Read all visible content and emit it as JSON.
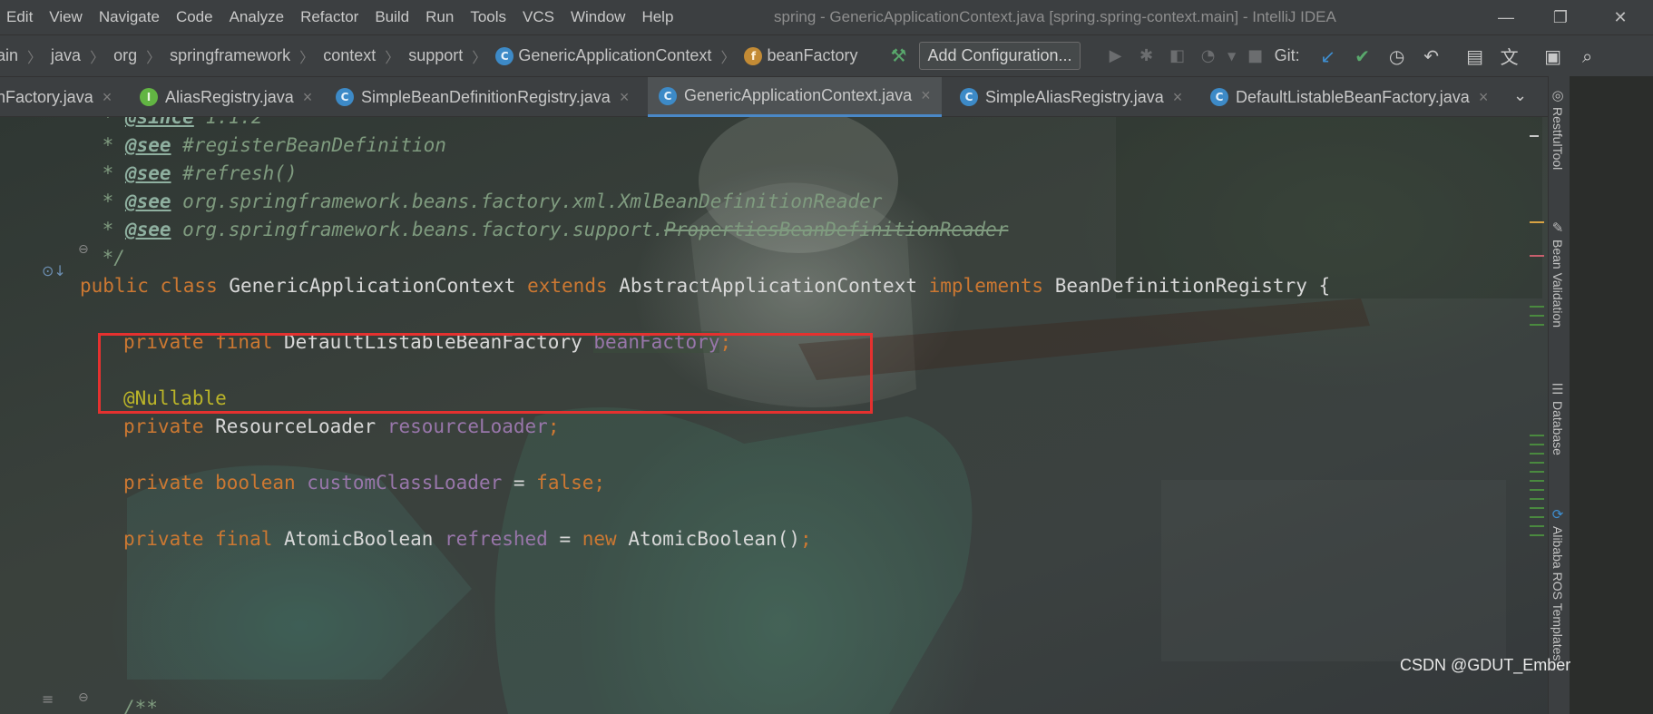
{
  "menu": {
    "items": [
      "Edit",
      "View",
      "Navigate",
      "Code",
      "Analyze",
      "Refactor",
      "Build",
      "Run",
      "Tools",
      "VCS",
      "Window",
      "Help"
    ],
    "window_title": "spring - GenericApplicationContext.java [spring.spring-context.main] - IntelliJ IDEA"
  },
  "window_controls": {
    "minimize": "—",
    "restore": "❐",
    "close": "✕"
  },
  "navbar": {
    "breadcrumbs": [
      "ain",
      "java",
      "org",
      "springframework",
      "context",
      "support",
      "GenericApplicationContext",
      "beanFactory"
    ],
    "add_configuration": "Add Configuration...",
    "git_label": "Git:"
  },
  "tabs": [
    {
      "label": "nFactory.java",
      "icon": "none",
      "active": false
    },
    {
      "label": "AliasRegistry.java",
      "icon": "interface-icon",
      "active": false
    },
    {
      "label": "SimpleBeanDefinitionRegistry.java",
      "icon": "class-icon",
      "active": false
    },
    {
      "label": "GenericApplicationContext.java",
      "icon": "class-icon",
      "active": true
    },
    {
      "label": "SimpleAliasRegistry.java",
      "icon": "class-icon",
      "active": false
    },
    {
      "label": "DefaultListableBeanFactory.java",
      "icon": "class-icon",
      "active": false
    }
  ],
  "code": {
    "l1": {
      "tag": "@since",
      "text": " 1.1.2"
    },
    "l2": {
      "tag": "@see",
      "text": " #registerBeanDefinition"
    },
    "l3": {
      "tag": "@see",
      "text": " #refresh()"
    },
    "l4": {
      "tag": "@see",
      "text": " org.springframework.beans.factory.xml.XmlBeanDefinitionReader"
    },
    "l5": {
      "tag": "@see",
      "pre": " org.springframework.beans.factory.support.",
      "struck": "PropertiesBeanDefinitionReader"
    },
    "l6": "*/",
    "l7": {
      "kw1": "public class ",
      "name": "GenericApplicationContext ",
      "kw2": "extends ",
      "parent": "AbstractApplicationContext ",
      "kw3": "implements ",
      "iface": "BeanDefinitionRegistry ",
      "brace": "{"
    },
    "l8": {
      "kw": "private final ",
      "type": "DefaultListableBeanFactory ",
      "field": "beanFactory",
      "end": ";"
    },
    "l9": "@Nullable",
    "l10": {
      "kw": "private ",
      "type": "ResourceLoader ",
      "field": "resourceLoader",
      "end": ";"
    },
    "l11": {
      "kw": "private boolean ",
      "field": "customClassLoader",
      "eq": " = ",
      "val": "false",
      "end": ";"
    },
    "l12": {
      "kw": "private final ",
      "type": "AtomicBoolean ",
      "field": "refreshed",
      "eq": " = ",
      "kw2": "new ",
      "call": "AtomicBoolean()",
      "end": ";"
    },
    "l13": "/**"
  },
  "sidebar_tools": [
    "RestfulTool",
    "Bean Validation",
    "Database",
    "Alibaba ROS Templates"
  ],
  "watermark": "CSDN @GDUT_Ember",
  "colors": {
    "keyword": "#cc7832",
    "field": "#9876aa",
    "annotation": "#bbb529",
    "highlight_box": "#e5312f",
    "active_tab_underline": "#4a88c7"
  }
}
